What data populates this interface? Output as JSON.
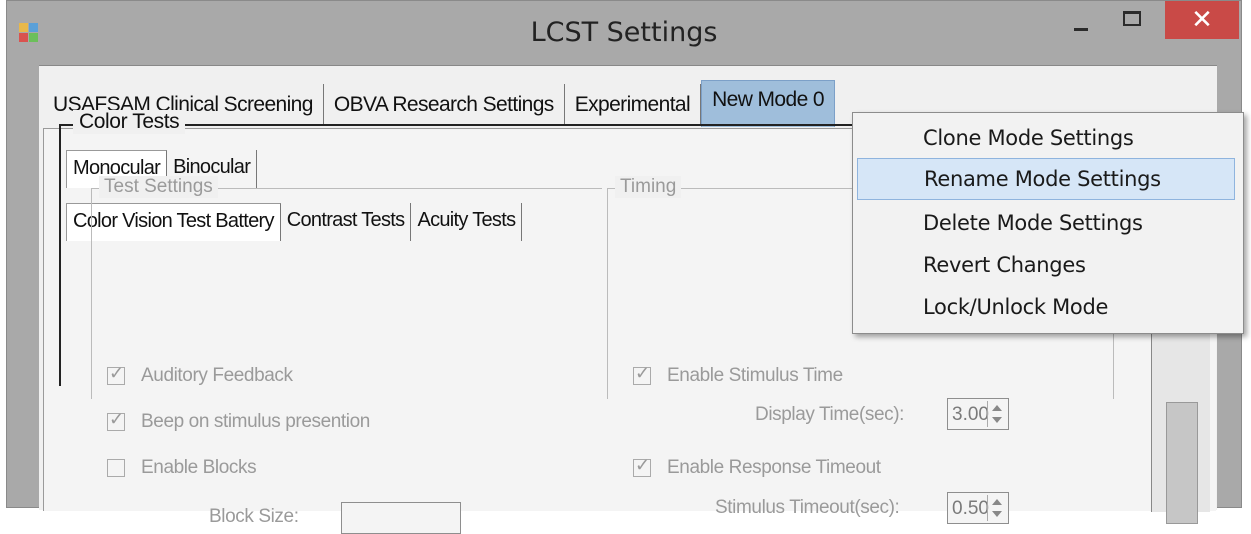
{
  "window": {
    "title": "LCST Settings",
    "close_glyph": "✕"
  },
  "mode_tabs": [
    "USAFSAM Clinical Screening",
    "OBVA Research Settings",
    "Experimental",
    "New Mode 0"
  ],
  "eye_tabs": [
    "Monocular",
    "Binocular"
  ],
  "test_tabs": [
    "Color Vision Test Battery",
    "Contrast Tests",
    "Acuity Tests"
  ],
  "color_tests": {
    "title": "Color Tests",
    "test_settings": {
      "title": "Test Settings",
      "items": [
        {
          "label": "Auditory Feedback",
          "checked": true
        },
        {
          "label": "Beep on stimulus presention",
          "checked": true
        },
        {
          "label": "Enable Blocks",
          "checked": false
        }
      ],
      "block_size_label": "Block Size:"
    },
    "timing": {
      "title": "Timing",
      "enable_stimulus_time": "Enable Stimulus Time",
      "display_time_label": "Display Time(sec):",
      "display_time_value": "3.00",
      "enable_response_timeout": "Enable Response Timeout",
      "stimulus_timeout_label": "Stimulus Timeout(sec):",
      "stimulus_timeout_value": "0.50"
    }
  },
  "context_menu": {
    "items": [
      "Clone Mode Settings",
      "Rename Mode Settings",
      "Delete Mode Settings",
      "Revert Changes",
      "Lock/Unlock Mode"
    ],
    "highlighted_index": 1
  },
  "colors": {
    "active_tab": "#9fbedb",
    "menu_highlight": "#d6e6f7",
    "close_button": "#c94a47"
  },
  "icons": [
    "app-icon",
    "minimize-icon",
    "maximize-icon",
    "close-icon",
    "checkbox-checked-icon",
    "spin-arrows-icon"
  ]
}
